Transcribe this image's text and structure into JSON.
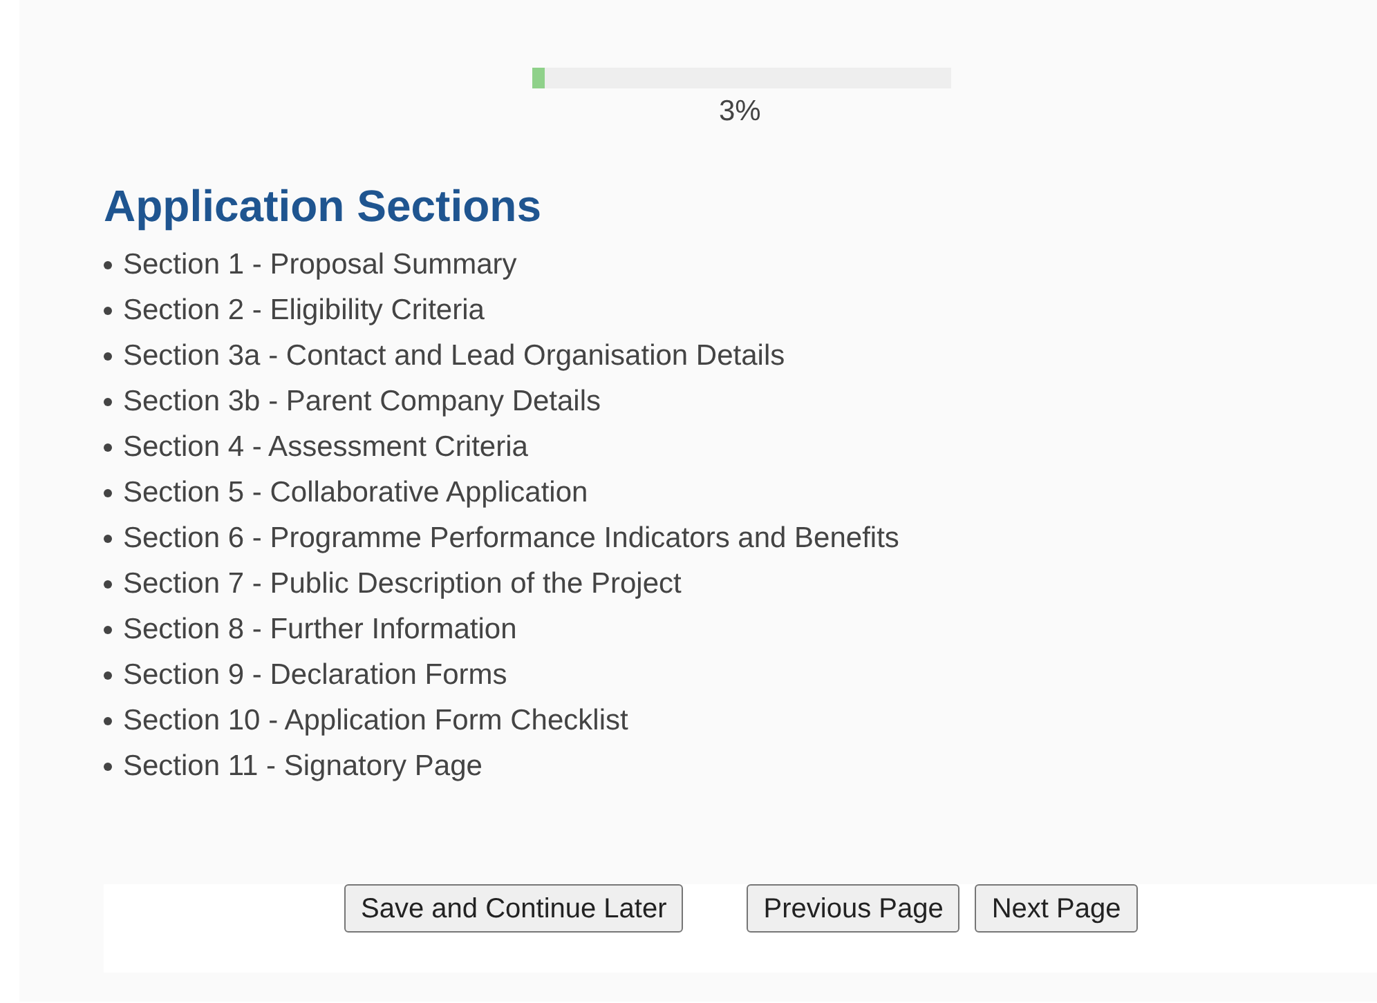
{
  "progress": {
    "level": 0.03,
    "label": "3%"
  },
  "heading": "Application Sections",
  "sections": [
    "Section 1 - Proposal Summary",
    "Section 2 - Eligibility Criteria",
    "Section 3a - Contact and Lead Organisation Details",
    "Section 3b - Parent Company Details",
    "Section 4 - Assessment Criteria",
    "Section 5 - Collaborative Application",
    "Section 6 - Programme Performance Indicators and Benefits",
    "Section 7 - Public Description of the Project",
    "Section 8 - Further Information",
    "Section 9 - Declaration Forms",
    "Section 10 - Application Form Checklist",
    "Section 11 - Signatory Page"
  ],
  "buttons": {
    "save": "Save and Continue Later",
    "previous": "Previous Page",
    "next": "Next Page"
  }
}
